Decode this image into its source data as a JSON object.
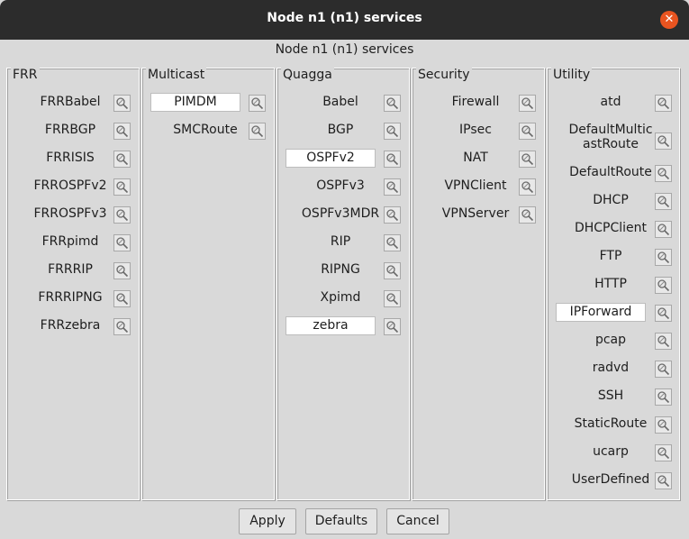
{
  "window": {
    "title": "Node n1 (n1) services",
    "heading": "Node n1 (n1) services"
  },
  "columns": [
    {
      "name": "FRR",
      "services": [
        {
          "label": "FRRBabel",
          "selected": false
        },
        {
          "label": "FRRBGP",
          "selected": false
        },
        {
          "label": "FRRISIS",
          "selected": false
        },
        {
          "label": "FRROSPFv2",
          "selected": false
        },
        {
          "label": "FRROSPFv3",
          "selected": false
        },
        {
          "label": "FRRpimd",
          "selected": false
        },
        {
          "label": "FRRRIP",
          "selected": false
        },
        {
          "label": "FRRRIPNG",
          "selected": false
        },
        {
          "label": "FRRzebra",
          "selected": false
        }
      ]
    },
    {
      "name": "Multicast",
      "services": [
        {
          "label": "PIMDM",
          "selected": true
        },
        {
          "label": "SMCRoute",
          "selected": false
        }
      ]
    },
    {
      "name": "Quagga",
      "services": [
        {
          "label": "Babel",
          "selected": false
        },
        {
          "label": "BGP",
          "selected": false
        },
        {
          "label": "OSPFv2",
          "selected": true
        },
        {
          "label": "OSPFv3",
          "selected": false
        },
        {
          "label": "OSPFv3MDR",
          "selected": false
        },
        {
          "label": "RIP",
          "selected": false
        },
        {
          "label": "RIPNG",
          "selected": false
        },
        {
          "label": "Xpimd",
          "selected": false
        },
        {
          "label": "zebra",
          "selected": true
        }
      ]
    },
    {
      "name": "Security",
      "services": [
        {
          "label": "Firewall",
          "selected": false
        },
        {
          "label": "IPsec",
          "selected": false
        },
        {
          "label": "NAT",
          "selected": false
        },
        {
          "label": "VPNClient",
          "selected": false
        },
        {
          "label": "VPNServer",
          "selected": false
        }
      ]
    },
    {
      "name": "Utility",
      "services": [
        {
          "label": "atd",
          "selected": false
        },
        {
          "label": "DefaultMulticastRoute",
          "line1": "DefaultMultic",
          "line2": "astRoute",
          "selected": false
        },
        {
          "label": "DefaultRoute",
          "selected": false
        },
        {
          "label": "DHCP",
          "selected": false
        },
        {
          "label": "DHCPClient",
          "selected": false
        },
        {
          "label": "FTP",
          "selected": false
        },
        {
          "label": "HTTP",
          "selected": false
        },
        {
          "label": "IPForward",
          "selected": true
        },
        {
          "label": "pcap",
          "selected": false
        },
        {
          "label": "radvd",
          "selected": false
        },
        {
          "label": "SSH",
          "selected": false
        },
        {
          "label": "StaticRoute",
          "selected": false
        },
        {
          "label": "ucarp",
          "selected": false
        },
        {
          "label": "UserDefined",
          "selected": false
        }
      ]
    }
  ],
  "buttons": {
    "apply": "Apply",
    "defaults": "Defaults",
    "cancel": "Cancel"
  },
  "icons": {
    "close": "close-icon",
    "configure": "configure-icon"
  },
  "colors": {
    "titlebar": "#2c2c2c",
    "close": "#e95420",
    "background": "#d9d9d9",
    "selected": "#ffffff"
  }
}
